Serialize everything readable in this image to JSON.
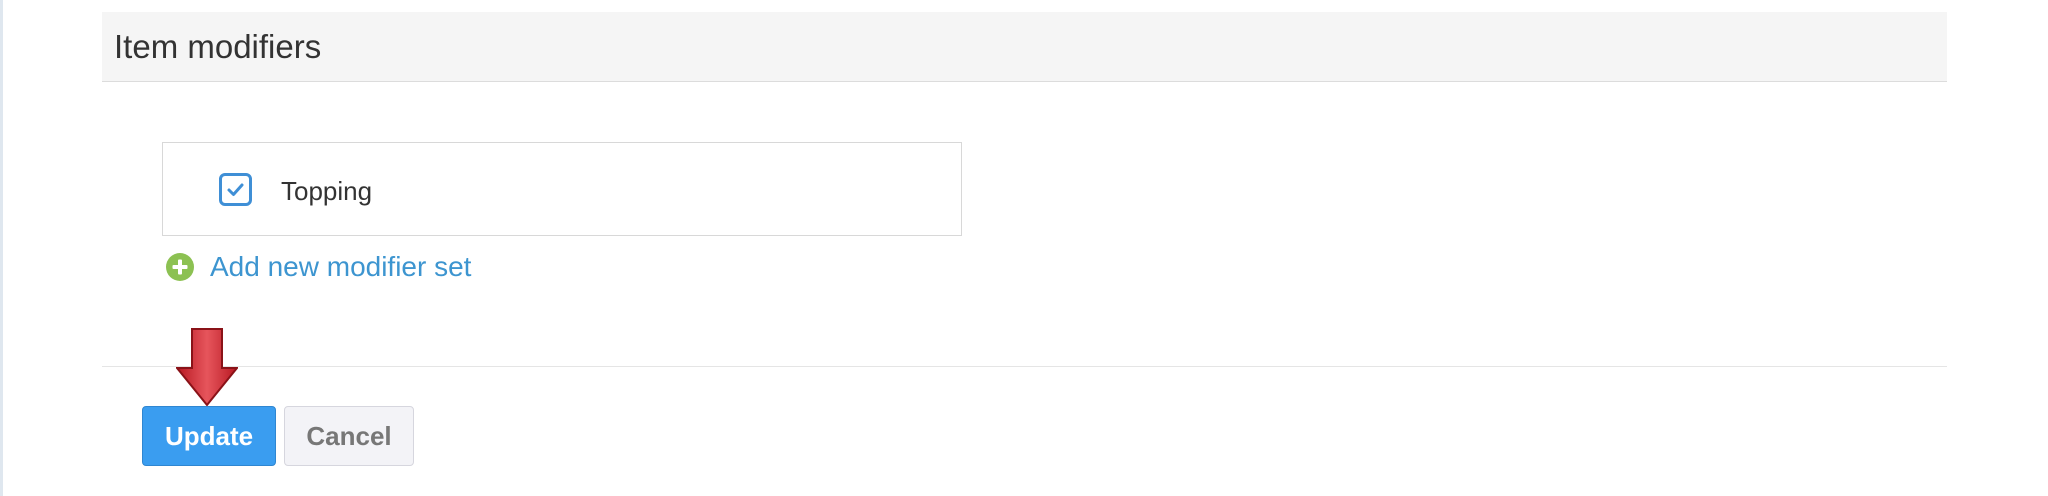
{
  "section": {
    "title": "Item modifiers"
  },
  "modifier_sets": [
    {
      "label": "Topping",
      "checked": true
    }
  ],
  "add_modifier_link": {
    "label": "Add new modifier set",
    "icon": "plus-circle-icon"
  },
  "actions": {
    "update_label": "Update",
    "cancel_label": "Cancel"
  },
  "annotation": {
    "icon": "red-down-arrow-icon"
  },
  "colors": {
    "primary": "#3a9df0",
    "link": "#3d95d0",
    "add_icon": "#8cc152",
    "checkbox": "#3f8fd6",
    "arrow": "#d0202a"
  }
}
